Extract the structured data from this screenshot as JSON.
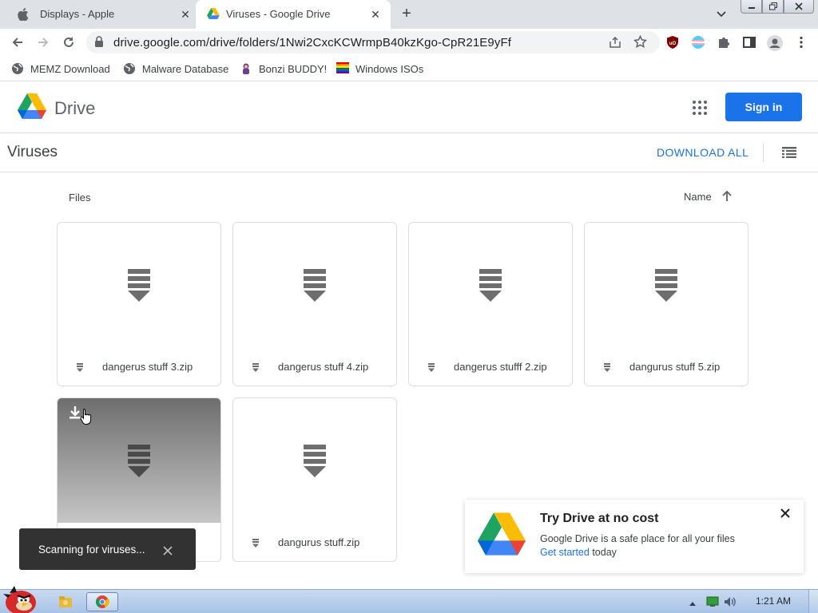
{
  "browser": {
    "tabs": [
      {
        "label": "Displays - Apple",
        "icon": "apple-icon",
        "active": false
      },
      {
        "label": "Viruses - Google Drive",
        "icon": "google-drive-icon",
        "active": true
      }
    ],
    "url": "drive.google.com/drive/folders/1Nwi2CxcKCWrmpB40kzKgo-CpR21E9yFf",
    "bookmarks": [
      {
        "label": "MEMZ Download",
        "icon": "globe-icon"
      },
      {
        "label": "Malware Database",
        "icon": "globe-icon"
      },
      {
        "label": "Bonzi BUDDY!",
        "icon": "bonzi-icon"
      },
      {
        "label": "Windows ISOs",
        "icon": "windows-flag-icon"
      }
    ]
  },
  "drive": {
    "product_name": "Drive",
    "signin_label": "Sign in",
    "folder_title": "Viruses",
    "download_all_label": "DOWNLOAD ALL",
    "files_heading": "Files",
    "sort_label": "Name",
    "files": [
      {
        "name": "dangerus stuff 3.zip"
      },
      {
        "name": "dangerus stuff 4.zip"
      },
      {
        "name": "dangerus stufff 2.zip"
      },
      {
        "name": "dangurus stuff 5.zip"
      },
      {
        "name": "",
        "hovered": true
      },
      {
        "name": "dangurus stuff.zip"
      }
    ]
  },
  "promo": {
    "title": "Try Drive at no cost",
    "description": "Google Drive is a safe place for all your files",
    "link_label": "Get started",
    "link_suffix": " today"
  },
  "snackbar": {
    "text": "Scanning for viruses..."
  },
  "taskbar": {
    "clock": "1:21 AM"
  },
  "colors": {
    "accent": "#1a73e8",
    "tab_strip": "#dee1e6",
    "snackbar_bg": "#323232"
  }
}
